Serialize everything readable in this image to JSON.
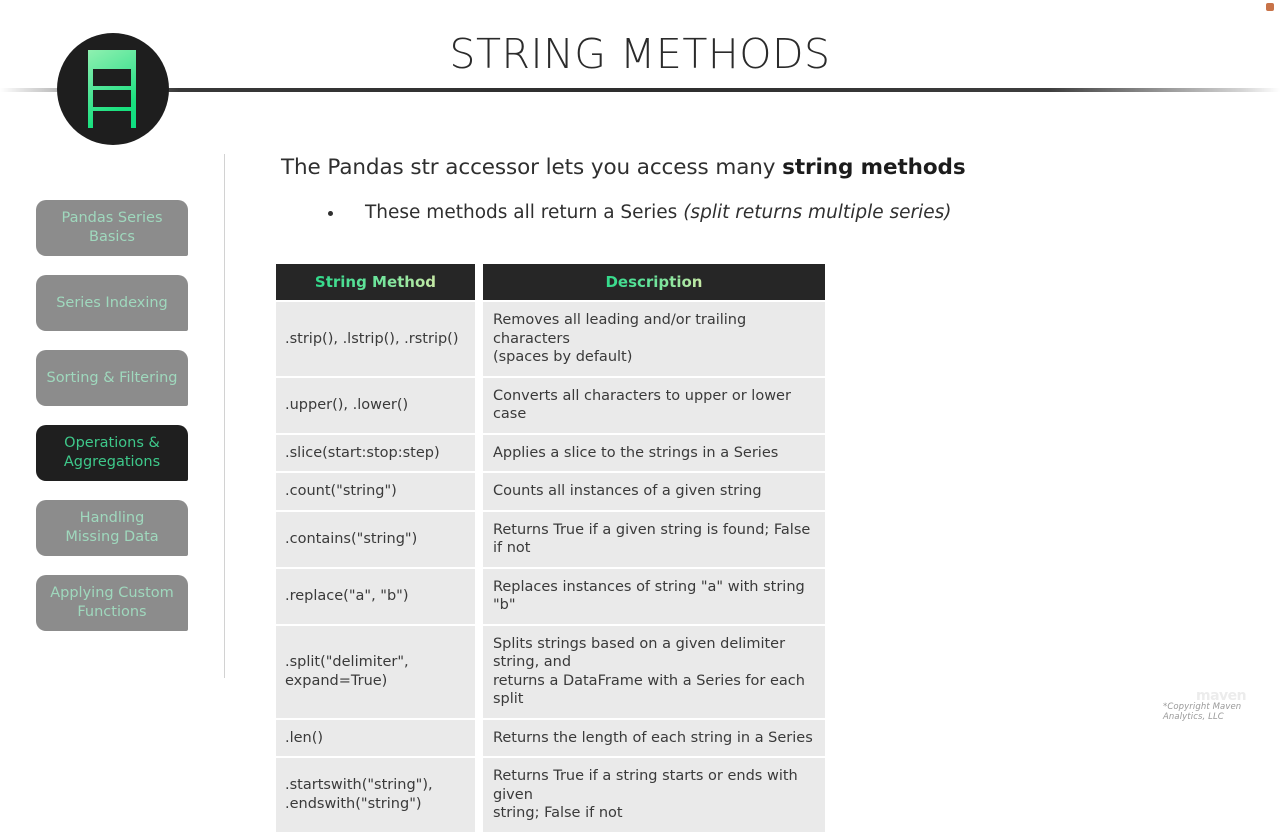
{
  "slide": {
    "title": "STRING METHODS",
    "corner_marker": "orange-dot",
    "accent_green": "#2fd98a",
    "accent_green_light": "#c8e9a6",
    "active_nav_bg": "#1f1f1f",
    "nav_bg": "#8c8c8c"
  },
  "logo": {
    "name": "maven-analytics-logo"
  },
  "sidebar": {
    "items": [
      {
        "label": "Pandas Series\nBasics",
        "active": false
      },
      {
        "label": "Series Indexing",
        "active": false
      },
      {
        "label": "Sorting & Filtering",
        "active": false
      },
      {
        "label": "Operations &\nAggregations",
        "active": true
      },
      {
        "label": "Handling\nMissing Data",
        "active": false
      },
      {
        "label": "Applying Custom\nFunctions",
        "active": false
      }
    ]
  },
  "body": {
    "lead_before": "The Pandas str accessor lets you access many ",
    "lead_bold": "string methods",
    "bullet_before": "These methods all return a Series ",
    "bullet_italic": "(split returns multiple series)"
  },
  "table": {
    "headers": [
      "String Method",
      "Description"
    ],
    "rows": [
      {
        "method": ".strip(), .lstrip(), .rstrip()",
        "description": "Removes all leading and/or trailing characters\n(spaces by default)"
      },
      {
        "method": ".upper(), .lower()",
        "description": "Converts all characters to upper or lower case"
      },
      {
        "method": ".slice(start:stop:step)",
        "description": "Applies a slice to the strings in a Series"
      },
      {
        "method": ".count(\"string\")",
        "description": "Counts all instances of a given string"
      },
      {
        "method": ".contains(\"string\")",
        "description": "Returns True if a given string is found; False if not"
      },
      {
        "method": ".replace(\"a\", \"b\")",
        "description": "Replaces instances of string \"a\" with string \"b\""
      },
      {
        "method": ".split(\"delimiter\",\nexpand=True)",
        "description": "Splits strings based on a given delimiter string, and\nreturns a DataFrame with a Series for each split"
      },
      {
        "method": ".len()",
        "description": "Returns the length of each string in a Series"
      },
      {
        "method": ".startswith(\"string\"),\n.endswith(\"string\")",
        "description": "Returns True if a string starts or ends with given\nstring; False if not"
      }
    ]
  },
  "footer": {
    "copyright": "*Copyright Maven Analytics, LLC",
    "watermark": "maven"
  }
}
